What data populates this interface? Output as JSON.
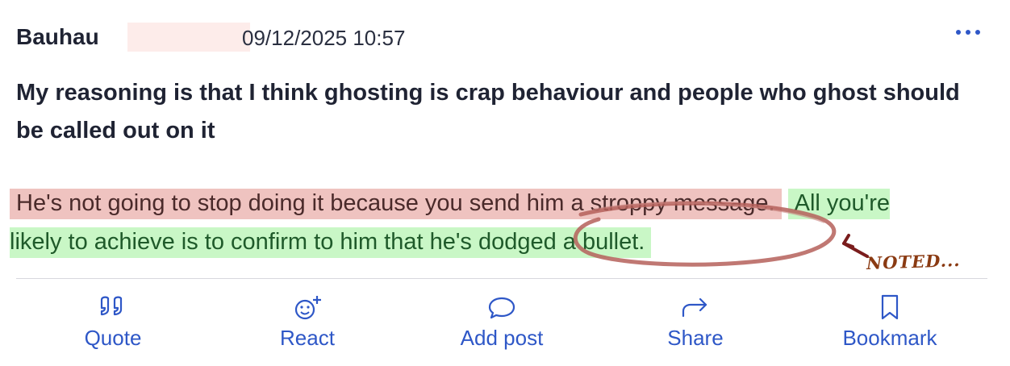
{
  "post": {
    "username": "Bauhau",
    "timestamp": "09/12/2025 10:57",
    "body_text": "My reasoning is that I think ghosting is crap behaviour and people who ghost should be called out on it",
    "quote_red": "He's not going to stop doing it because you send him a stroppy message.",
    "quote_green": "All you're likely to achieve is to confirm to him that he's dodged a bullet.",
    "annotation_text": "NOTED..."
  },
  "actions": [
    {
      "label": "Quote",
      "icon": "quote-icon"
    },
    {
      "label": "React",
      "icon": "react-icon"
    },
    {
      "label": "Add post",
      "icon": "comment-icon"
    },
    {
      "label": "Share",
      "icon": "share-icon"
    },
    {
      "label": "Bookmark",
      "icon": "bookmark-icon"
    }
  ],
  "colors": {
    "accent": "#2e57c7",
    "highlight_red": "#efc3c0",
    "highlight_green": "#c9f7c6",
    "annotation": "#8a3a12"
  }
}
